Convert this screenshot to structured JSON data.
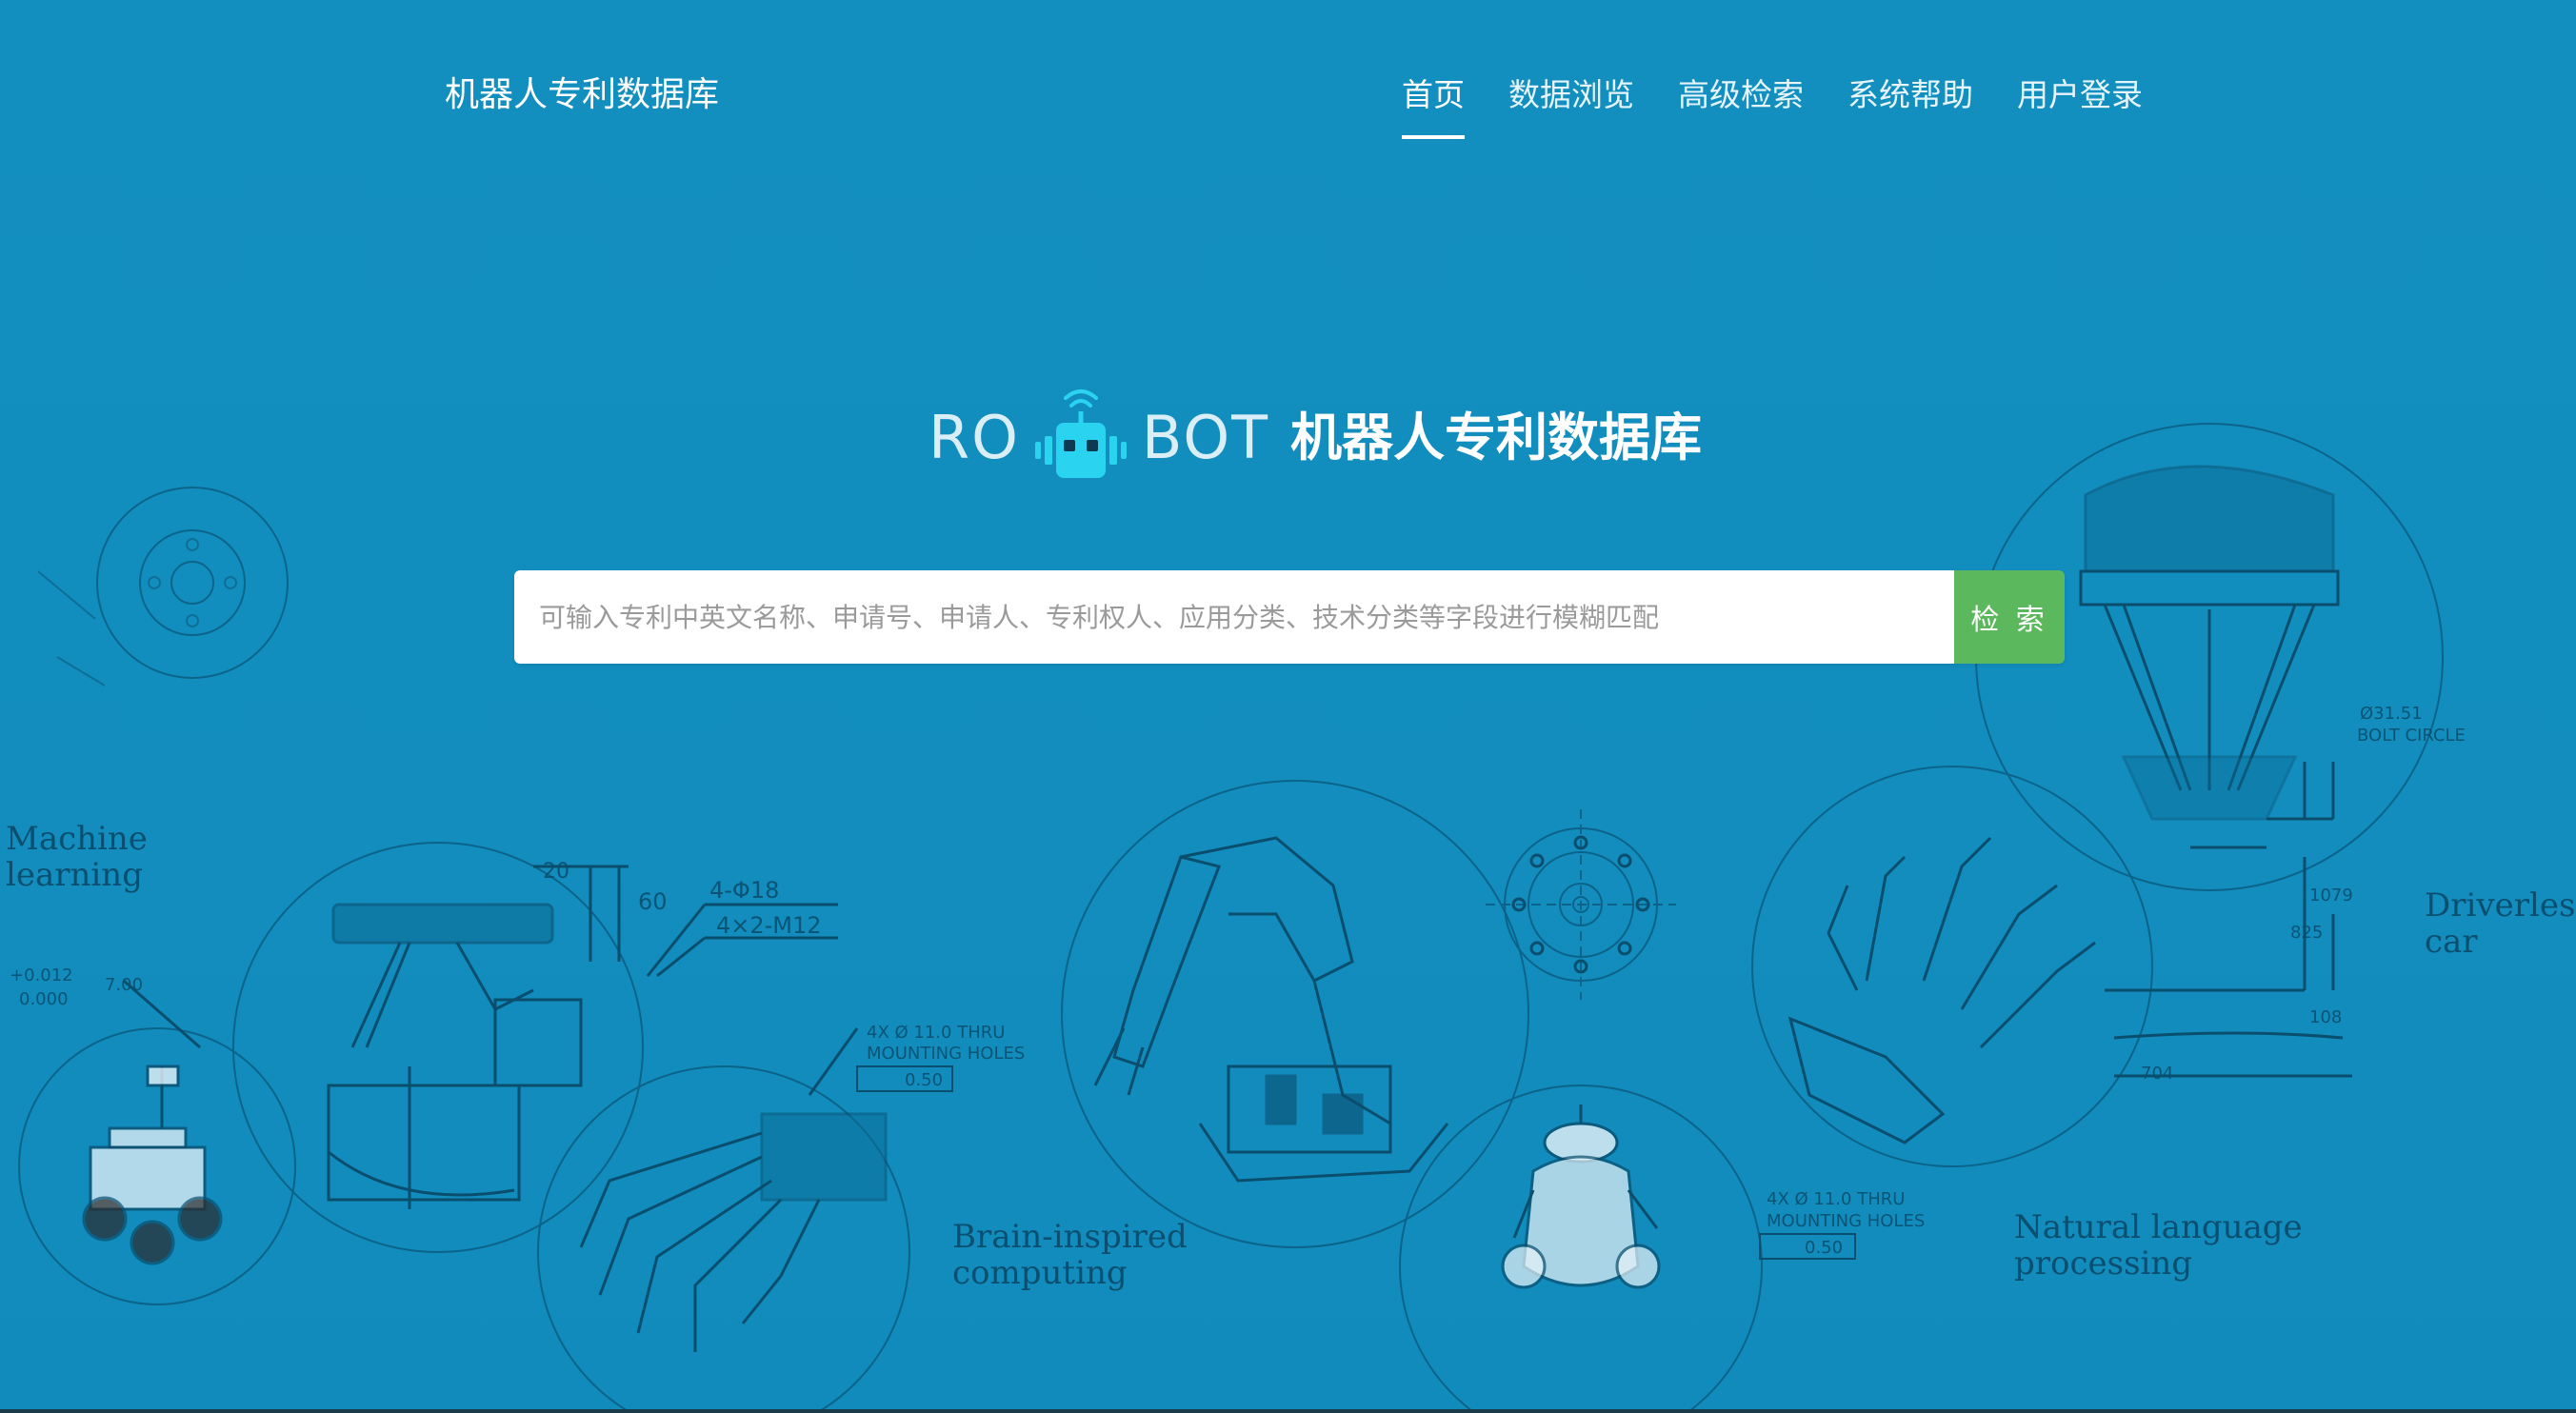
{
  "header": {
    "site_title": "机器人专利数据库",
    "nav": [
      {
        "label": "首页",
        "active": true
      },
      {
        "label": "数据浏览",
        "active": false
      },
      {
        "label": "高级检索",
        "active": false
      },
      {
        "label": "系统帮助",
        "active": false
      },
      {
        "label": "用户登录",
        "active": false
      }
    ]
  },
  "logo": {
    "ro": "RO",
    "bot": "BOT",
    "cn_title": "机器人专利数据库",
    "icon": "robot-head-icon"
  },
  "search": {
    "placeholder": "可输入专利中英文名称、申请号、申请人、专利权人、应用分类、技术分类等字段进行模糊匹配",
    "value": "",
    "button_label": "检 索"
  },
  "background_labels": {
    "machine_learning": [
      "Machine",
      "learning"
    ],
    "brain_inspired": [
      "Brain-inspired",
      "computing"
    ],
    "natural_language": [
      "Natural language",
      "processing"
    ],
    "driverless": [
      "Driverles",
      "car"
    ]
  },
  "drawing_annotations": {
    "tol_upper": "+0.012",
    "tol_lower": "0.000",
    "depth": "7.00",
    "dim_20": "20",
    "dim_60": "60",
    "hole_1": "4-Φ18",
    "hole_2": "4×2-M12",
    "holes_note_1": "4X Ø 11.0 THRU",
    "holes_note_2": "MOUNTING HOLES",
    "tol_box": "0.50",
    "bolt_circle_1": "Ø31.51",
    "bolt_circle_2": "BOLT CIRCLE",
    "dim_1079": "1079",
    "dim_825": "825",
    "dim_108": "108",
    "dim_704": "704"
  },
  "colors": {
    "background": "#128ebf",
    "search_button": "#5cb85c",
    "drawing_line": "#0a4e6e"
  }
}
